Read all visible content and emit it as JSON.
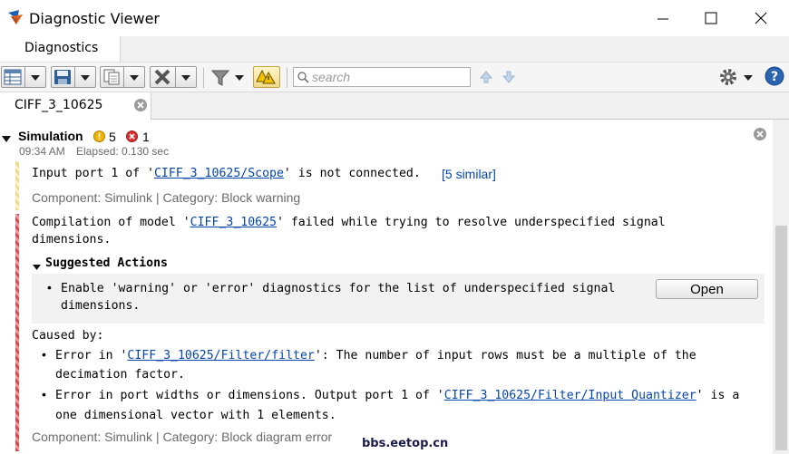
{
  "window": {
    "title": "Diagnostic Viewer",
    "icon": "matlab-icon"
  },
  "tabs": {
    "main": "Diagnostics",
    "document": "CIFF_3_10625"
  },
  "toolbar": {
    "search_placeholder": "search",
    "icons": [
      "table-view-icon",
      "save-icon",
      "copy-icon",
      "clear-icon",
      "filter-icon",
      "warning-group-icon",
      "search-icon",
      "up-arrow-icon",
      "down-arrow-icon",
      "gear-icon",
      "help-icon"
    ]
  },
  "simulation": {
    "title": "Simulation",
    "warning_count": "5",
    "error_count": "1",
    "time": "09:34 AM",
    "elapsed": "Elapsed: 0.130 sec"
  },
  "warning": {
    "text_before": "Input port 1 of '",
    "link": "CIFF_3_10625/Scope",
    "text_after": "' is not connected.",
    "similar": "[5 similar]",
    "meta": "Component:  Simulink | Category:  Block warning"
  },
  "error": {
    "line1_before": "Compilation of model '",
    "line1_link": "CIFF_3_10625",
    "line1_after": "' failed while trying to resolve underspecified signal",
    "line2": "dimensions.",
    "suggested_title": "Suggested Actions",
    "suggestion_line1": "Enable 'warning' or 'error' diagnostics for the list of underspecified signal",
    "suggestion_line2": "dimensions.",
    "open_button": "Open",
    "caused_by": "Caused by:",
    "cause1_before": "Error in '",
    "cause1_link": "CIFF_3_10625/Filter/filter",
    "cause1_after": "': The number of input rows must be a multiple of the",
    "cause1_line2": "decimation factor.",
    "cause2_before": "Error in port widths or dimensions. Output port 1 of '",
    "cause2_link": "CIFF_3_10625/Filter/Input Quantizer",
    "cause2_after": "' is a",
    "cause2_line2": "one dimensional vector with 1 elements.",
    "meta": "Component:  Simulink | Category:  Block diagram error"
  },
  "watermark": "bbs.eetop.cn",
  "colors": {
    "warning_stripe": "#f3d98a",
    "error_stripe": "#e0474c",
    "link": "#0645ad",
    "suggestion_bg": "#f2f2f2"
  }
}
